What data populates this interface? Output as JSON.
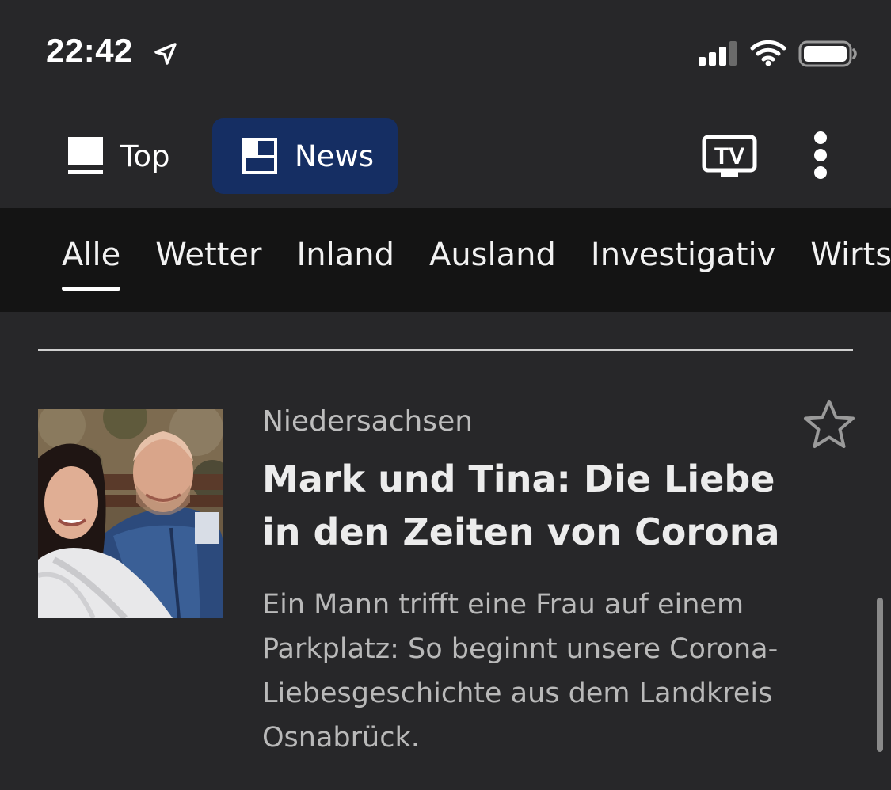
{
  "status_bar": {
    "time": "22:42",
    "icons": [
      "location-arrow-icon",
      "cellular-signal-icon",
      "wifi-icon",
      "battery-icon"
    ]
  },
  "top_nav": {
    "items": [
      {
        "label": "Top",
        "icon": "top-stories-icon",
        "active": false
      },
      {
        "label": "News",
        "icon": "news-layout-icon",
        "active": true
      }
    ],
    "tv_label": "TV",
    "more_icon": "more-vertical-icon",
    "active_color": "#152e63"
  },
  "categories": {
    "items": [
      "Alle",
      "Wetter",
      "Inland",
      "Ausland",
      "Investigativ",
      "Wirtschaft"
    ],
    "active": "Alle"
  },
  "article": {
    "topline": "Niedersachsen",
    "headline": "Mark und Tina: Die Liebe in den Zeiten von Corona",
    "teaser": "Ein Mann trifft eine Frau auf einem Parkplatz: So beginnt unsere Corona-Liebesgeschichte aus dem Landkreis Osnabrück.",
    "bookmark_icon": "star-outline-icon",
    "thumbnail": "couple-photo"
  }
}
